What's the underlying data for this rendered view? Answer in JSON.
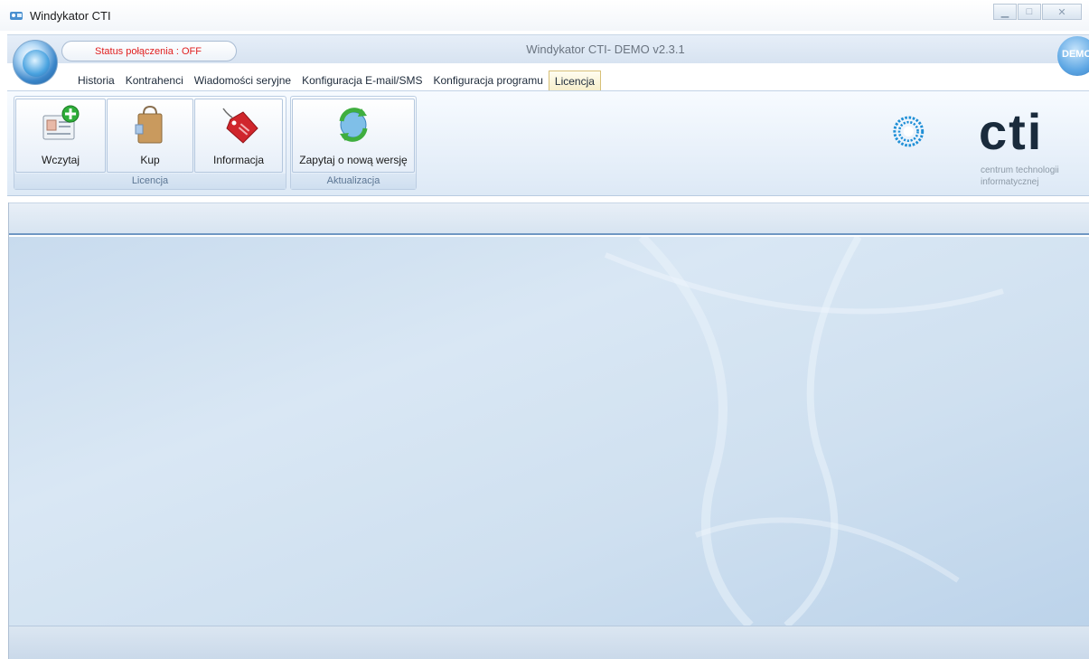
{
  "window": {
    "title": "Windykator CTI",
    "controls": [
      "minimize",
      "maximize",
      "close"
    ]
  },
  "header": {
    "status": "Status połączenia : OFF",
    "app_version": "Windykator CTI- DEMO v2.3.1",
    "demo_badge": "DEMO"
  },
  "tabs": [
    {
      "label": "Historia"
    },
    {
      "label": "Kontrahenci"
    },
    {
      "label": "Wiadomości seryjne"
    },
    {
      "label": "Konfiguracja E-mail/SMS"
    },
    {
      "label": "Konfiguracja programu"
    },
    {
      "label": "Licencja",
      "active": true
    }
  ],
  "ribbon": {
    "groups": [
      {
        "label": "Licencja",
        "buttons": [
          {
            "label": "Wczytaj",
            "icon": "id-card-add-icon"
          },
          {
            "label": "Kup",
            "icon": "shopping-bag-icon"
          },
          {
            "label": "Informacja",
            "icon": "price-tag-icon"
          }
        ]
      },
      {
        "label": "Aktualizacja",
        "buttons": [
          {
            "label": "Zapytaj o nową wersję",
            "icon": "refresh-globe-icon"
          }
        ]
      }
    ]
  },
  "logo": {
    "text": "cti",
    "subtitle_line1": "centrum technologii",
    "subtitle_line2": "informatycznej"
  },
  "colors": {
    "status_off": "#e02020",
    "accent": "#6f97c3",
    "logo_blue": "#1f8fd6",
    "logo_dark": "#1a2b3c"
  }
}
